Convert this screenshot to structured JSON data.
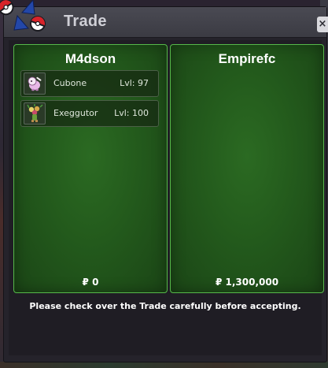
{
  "window": {
    "title": "Trade",
    "close_label": "×"
  },
  "left_panel": {
    "trader_name": "M4dson",
    "pokemon": [
      {
        "name": "Cubone",
        "level": "Lvl: 97",
        "icon": "cubone-sprite"
      },
      {
        "name": "Exeggutor",
        "level": "Lvl: 100",
        "icon": "exeggutor-sprite"
      }
    ],
    "money": "₽ 0"
  },
  "right_panel": {
    "trader_name": "Empirefc",
    "pokemon": [],
    "money": "₽ 1,300,000"
  },
  "notice": "Please check over the Trade carefully before accepting.",
  "colors": {
    "panel_green": "#235a1c",
    "panel_border": "#56b84a",
    "window_bg": "#25232b",
    "titlebar": "#3b3b43",
    "pokeball_red": "#d8232a",
    "pokeball_blue": "#2347a8"
  }
}
